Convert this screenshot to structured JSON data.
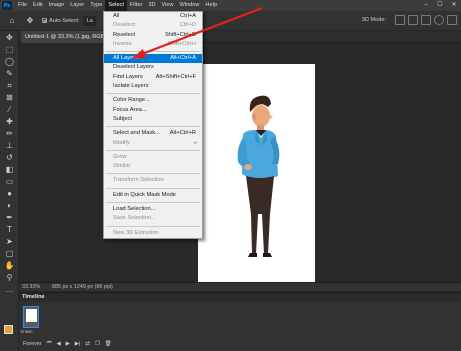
{
  "menubar": {
    "logo": "Ps",
    "items": [
      "File",
      "Edit",
      "Image",
      "Layer",
      "Type",
      "Select",
      "Filter",
      "3D",
      "View",
      "Window",
      "Help"
    ],
    "active_index": 5,
    "window_controls": [
      "–",
      "☐",
      "✕"
    ]
  },
  "options": {
    "auto_select_label": "Auto-Select:",
    "auto_select_value": "La",
    "mode_3d": "3D Mode:"
  },
  "document": {
    "tab_title": "Untitled-1 @ 33.3% (1.jpg, RGB"
  },
  "status": {
    "zoom": "33.33%",
    "doc_info": "885 px x 1249 px (96 ppi)"
  },
  "timeline": {
    "title": "Timeline",
    "frame_time": "0 sec.",
    "loop": "Forever"
  },
  "select_menu": {
    "items": [
      {
        "label": "All",
        "shortcut": "Ctrl+A",
        "disabled": false
      },
      {
        "label": "Deselect",
        "shortcut": "Ctrl+D",
        "disabled": true
      },
      {
        "label": "Reselect",
        "shortcut": "Shift+Ctrl+D",
        "disabled": false
      },
      {
        "label": "Inverse",
        "shortcut": "Shift+Ctrl+I",
        "disabled": true
      },
      {
        "sep": true
      },
      {
        "label": "All Layers",
        "shortcut": "Alt+Ctrl+A",
        "highlight": true
      },
      {
        "label": "Deselect Layers",
        "shortcut": "",
        "disabled": false
      },
      {
        "label": "Find Layers",
        "shortcut": "Alt+Shift+Ctrl+F",
        "disabled": false
      },
      {
        "label": "Isolate Layers",
        "shortcut": "",
        "disabled": false
      },
      {
        "sep": true
      },
      {
        "label": "Color Range...",
        "shortcut": "",
        "disabled": false
      },
      {
        "label": "Focus Area...",
        "shortcut": "",
        "disabled": false
      },
      {
        "label": "Subject",
        "shortcut": "",
        "disabled": false
      },
      {
        "sep": true
      },
      {
        "label": "Select and Mask...",
        "shortcut": "Alt+Ctrl+R",
        "disabled": false
      },
      {
        "label": "Modify",
        "shortcut": "",
        "disabled": true,
        "submenu": true
      },
      {
        "sep": true
      },
      {
        "label": "Grow",
        "shortcut": "",
        "disabled": true
      },
      {
        "label": "Similar",
        "shortcut": "",
        "disabled": true
      },
      {
        "sep": true
      },
      {
        "label": "Transform Selection",
        "shortcut": "",
        "disabled": true
      },
      {
        "sep": true
      },
      {
        "label": "Edit in Quick Mask Mode",
        "shortcut": "",
        "disabled": false
      },
      {
        "sep": true
      },
      {
        "label": "Load Selection...",
        "shortcut": "",
        "disabled": false
      },
      {
        "label": "Save Selection...",
        "shortcut": "",
        "disabled": true
      },
      {
        "sep": true
      },
      {
        "label": "New 3D Extrusion",
        "shortcut": "",
        "disabled": true
      }
    ]
  },
  "colors": {
    "accent": "#0078d7",
    "annotation": "#e02020",
    "foreground": "#e8a23a",
    "background": "#ffffff"
  }
}
